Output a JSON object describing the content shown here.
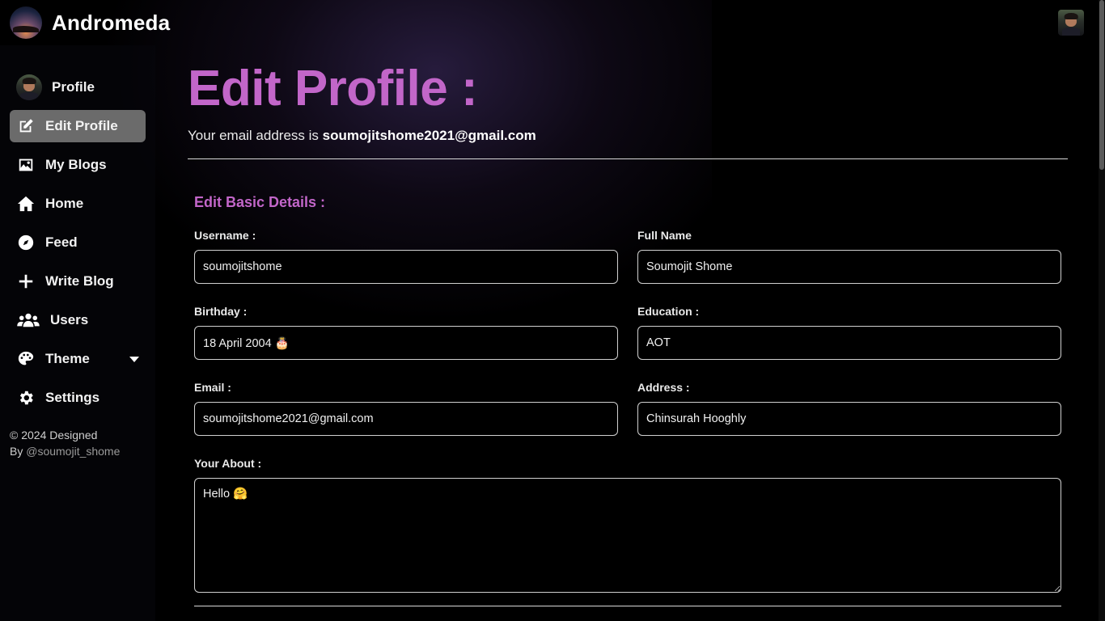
{
  "app": {
    "name": "Andromeda"
  },
  "sidebar": {
    "items": [
      {
        "label": "Profile",
        "icon": "user-avatar"
      },
      {
        "label": "Edit Profile",
        "icon": "edit-icon",
        "active": true
      },
      {
        "label": "My Blogs",
        "icon": "image-icon"
      },
      {
        "label": "Home",
        "icon": "home-icon"
      },
      {
        "label": "Feed",
        "icon": "compass-icon"
      },
      {
        "label": "Write Blog",
        "icon": "plus-icon"
      },
      {
        "label": "Users",
        "icon": "users-icon"
      },
      {
        "label": "Theme",
        "icon": "palette-icon"
      },
      {
        "label": "Settings",
        "icon": "gear-icon"
      }
    ],
    "footer_line1": "© 2024 Designed",
    "footer_by": "By",
    "footer_handle": "@soumojit_shome"
  },
  "main": {
    "title": "Edit Profile :",
    "email_prefix": "Your email address is",
    "email": "soumojitshome2021@gmail.com",
    "section_title": "Edit Basic Details :",
    "fields": {
      "username": {
        "label": "Username :",
        "value": "soumojitshome"
      },
      "full_name": {
        "label": "Full Name",
        "value": "Soumojit Shome"
      },
      "birthday": {
        "label": "Birthday :",
        "value": "18 April 2004 🎂"
      },
      "education": {
        "label": "Education :",
        "value": "AOT"
      },
      "email": {
        "label": "Email :",
        "value": "soumojitshome2021@gmail.com"
      },
      "address": {
        "label": "Address :",
        "value": "Chinsurah Hooghly"
      },
      "about": {
        "label": "Your About :",
        "value": "Hello 🤗"
      }
    }
  },
  "colors": {
    "accent": "#c266c9",
    "active_nav_bg": "#6b6b6b",
    "background": "#000000"
  }
}
